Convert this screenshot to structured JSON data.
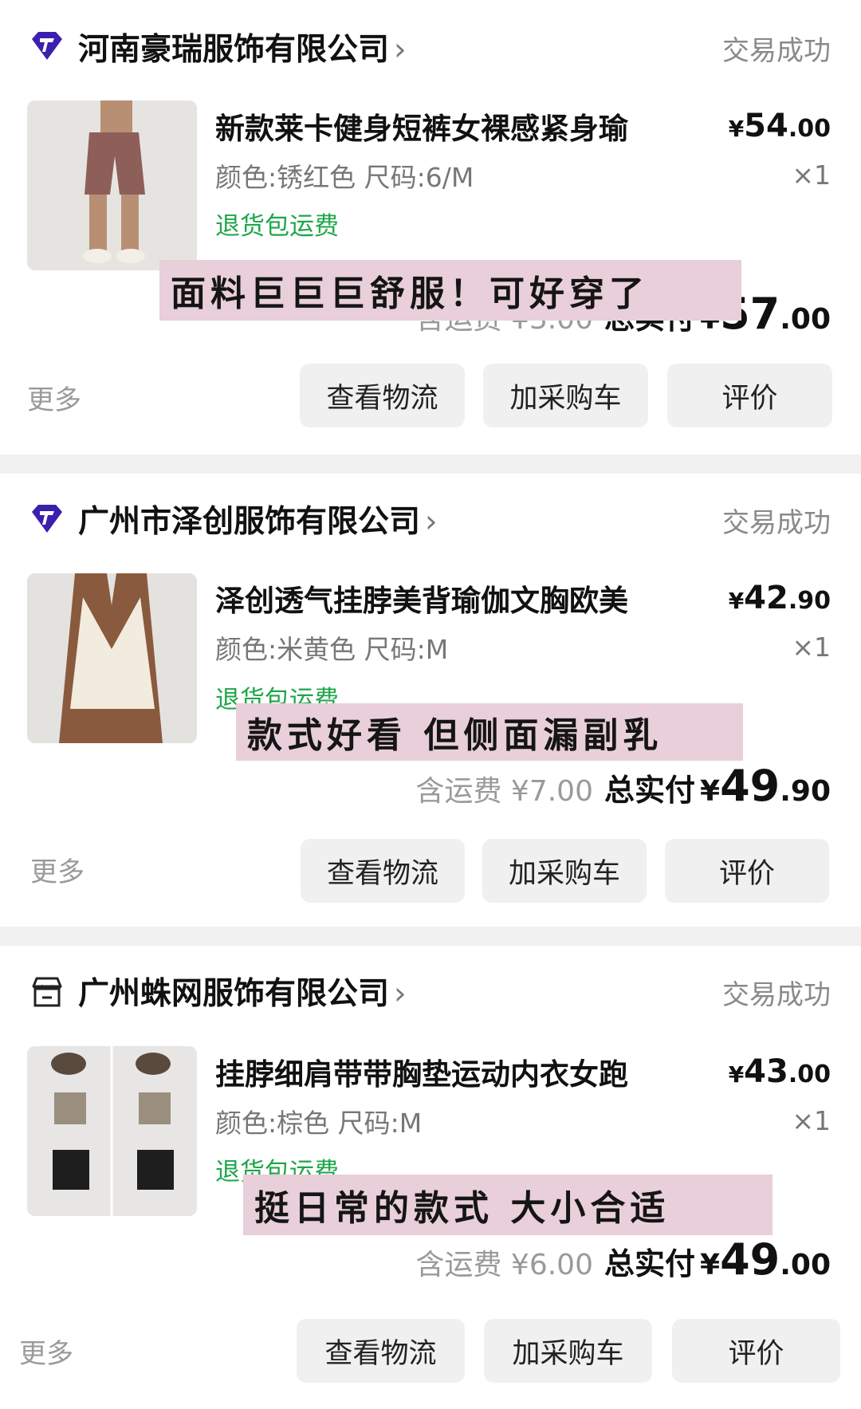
{
  "orders": [
    {
      "shop": "河南豪瑞服饰有限公司",
      "shop_icon": "brand-diamond-icon",
      "status": "交易成功",
      "product": {
        "title": "新款莱卡健身短裤女裸感紧身瑜",
        "spec": "颜色:锈红色 尺码:6/M",
        "tag": "退货包运费",
        "price_int": "54",
        "price_dec": ".00",
        "qty": "×1"
      },
      "total": {
        "shipping": "含运费 ¥3.00",
        "label": "总实付",
        "int": "57",
        "dec": ".00"
      },
      "note": "面料巨巨巨舒服！可好穿了",
      "more": "更多",
      "buttons": [
        "查看物流",
        "加采购车",
        "评价"
      ]
    },
    {
      "shop": "广州市泽创服饰有限公司",
      "shop_icon": "brand-diamond-icon",
      "status": "交易成功",
      "product": {
        "title": "泽创透气挂脖美背瑜伽文胸欧美",
        "spec": "颜色:米黄色 尺码:M",
        "tag": "退货包运费",
        "price_int": "42",
        "price_dec": ".90",
        "qty": "×1"
      },
      "total": {
        "shipping": "含运费 ¥7.00",
        "label": "总实付",
        "int": "49",
        "dec": ".90"
      },
      "note": "款式好看 但侧面漏副乳",
      "more": "更多",
      "buttons": [
        "查看物流",
        "加采购车",
        "评价"
      ]
    },
    {
      "shop": "广州蛛网服饰有限公司",
      "shop_icon": "store-icon",
      "status": "交易成功",
      "product": {
        "title": "挂脖细肩带带胸垫运动内衣女跑",
        "spec": "颜色:棕色 尺码:M",
        "tag": "退货包运费",
        "price_int": "43",
        "price_dec": ".00",
        "qty": "×1"
      },
      "total": {
        "shipping": "含运费 ¥6.00",
        "label": "总实付",
        "int": "49",
        "dec": ".00"
      },
      "note": "挺日常的款式 大小合适",
      "more": "更多",
      "buttons": [
        "查看物流",
        "加采购车",
        "评价"
      ]
    }
  ],
  "currency": "¥",
  "colors": {
    "status_gray": "#8a8a8a",
    "tag_green": "#1fa64a",
    "brand_purple": "#3b1fae",
    "overlay_pink": "#e8cfd9",
    "button_bg": "#f0f0f0"
  }
}
